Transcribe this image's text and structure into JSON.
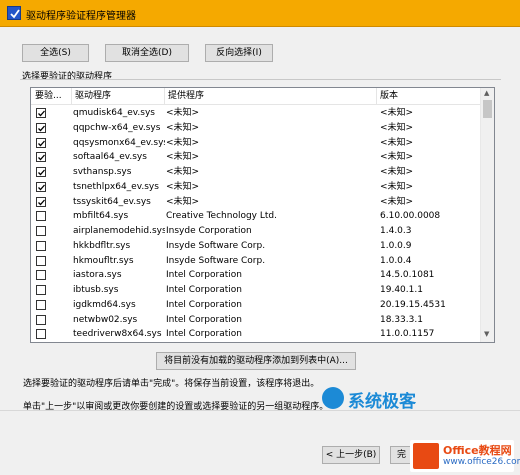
{
  "window": {
    "title": "驱动程序验证程序管理器"
  },
  "toolbar": {
    "select_all": "全选(S)",
    "deselect_all": "取消全选(D)",
    "invert": "反向选择(I)"
  },
  "group_label": "选择要验证的驱动程序",
  "table": {
    "headers": [
      "要验...",
      "驱动程序",
      "提供程序",
      "版本"
    ],
    "rows": [
      {
        "checked": true,
        "driver": "qmudisk64_ev.sys",
        "provider": "<未知>",
        "version": "<未知>"
      },
      {
        "checked": true,
        "driver": "qqpchw-x64_ev.sys",
        "provider": "<未知>",
        "version": "<未知>"
      },
      {
        "checked": true,
        "driver": "qqsysmonx64_ev.sys",
        "provider": "<未知>",
        "version": "<未知>"
      },
      {
        "checked": true,
        "driver": "softaal64_ev.sys",
        "provider": "<未知>",
        "version": "<未知>"
      },
      {
        "checked": true,
        "driver": "svthansp.sys",
        "provider": "<未知>",
        "version": "<未知>"
      },
      {
        "checked": true,
        "driver": "tsnethlpx64_ev.sys",
        "provider": "<未知>",
        "version": "<未知>"
      },
      {
        "checked": true,
        "driver": "tssyskit64_ev.sys",
        "provider": "<未知>",
        "version": "<未知>"
      },
      {
        "checked": false,
        "driver": "mbfilt64.sys",
        "provider": "Creative Technology Ltd.",
        "version": "6.10.00.0008"
      },
      {
        "checked": false,
        "driver": "airplanemodehid.sys",
        "provider": "Insyde Corporation",
        "version": "1.4.0.3"
      },
      {
        "checked": false,
        "driver": "hkkbdfltr.sys",
        "provider": "Insyde Software Corp.",
        "version": "1.0.0.9"
      },
      {
        "checked": false,
        "driver": "hkmoufltr.sys",
        "provider": "Insyde Software Corp.",
        "version": "1.0.0.4"
      },
      {
        "checked": false,
        "driver": "iastora.sys",
        "provider": "Intel Corporation",
        "version": "14.5.0.1081"
      },
      {
        "checked": false,
        "driver": "ibtusb.sys",
        "provider": "Intel Corporation",
        "version": "19.40.1.1"
      },
      {
        "checked": false,
        "driver": "igdkmd64.sys",
        "provider": "Intel Corporation",
        "version": "20.19.15.4531"
      },
      {
        "checked": false,
        "driver": "netwbw02.sys",
        "provider": "Intel Corporation",
        "version": "18.33.3.1"
      },
      {
        "checked": false,
        "driver": "teedriverw8x64.sys",
        "provider": "Intel Corporation",
        "version": "11.0.0.1157"
      }
    ]
  },
  "add_unloaded_button": "将目前没有加载的驱动程序添加到列表中(A)...",
  "info_line1": "选择要验证的驱动程序后请单击\"完成\"。将保存当前设置，该程序将退出。",
  "info_line2": "单击\"上一步\"以审阅或更改你要创建的设置或选择要验证的另一组驱动程序。",
  "footer": {
    "back": "< 上一步(B)",
    "finish": "完"
  },
  "watermark": "系统极客",
  "office_logo": {
    "line1": "Office教程网",
    "line2": "www.office26.com"
  },
  "colors": {
    "titlebar": "#f5a900",
    "watermark": "#1c8ad6",
    "office_orange": "#e84a13"
  }
}
